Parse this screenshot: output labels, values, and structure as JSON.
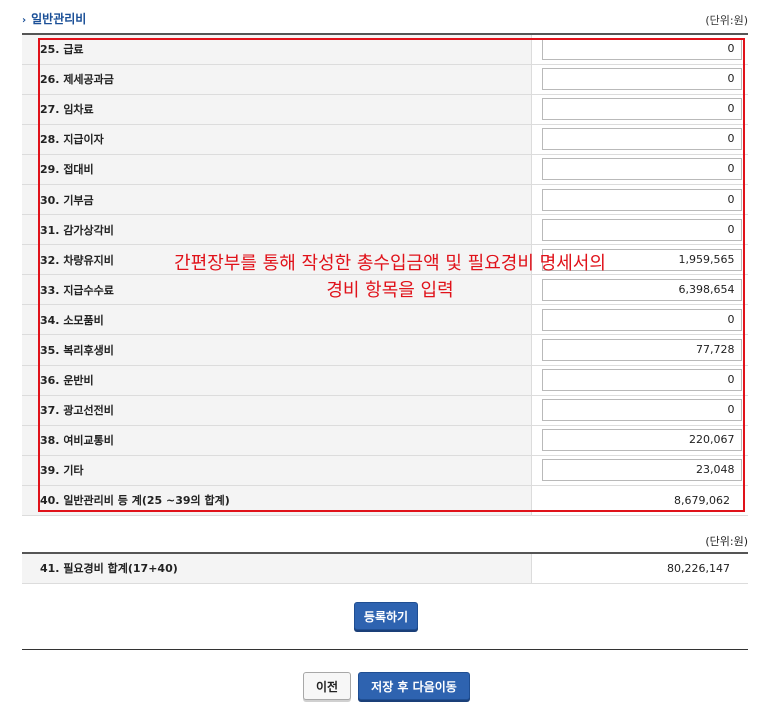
{
  "section": {
    "title": "일반관리비",
    "unit": "(단위:원)"
  },
  "rows": [
    {
      "label": "25. 급료",
      "value": "0"
    },
    {
      "label": "26. 제세공과금",
      "value": "0"
    },
    {
      "label": "27. 임차료",
      "value": "0"
    },
    {
      "label": "28. 지급이자",
      "value": "0"
    },
    {
      "label": "29. 접대비",
      "value": "0"
    },
    {
      "label": "30. 기부금",
      "value": "0"
    },
    {
      "label": "31. 감가상각비",
      "value": "0"
    },
    {
      "label": "32. 차량유지비",
      "value": "1,959,565"
    },
    {
      "label": "33. 지급수수료",
      "value": "6,398,654"
    },
    {
      "label": "34. 소모품비",
      "value": "0"
    },
    {
      "label": "35. 복리후생비",
      "value": "77,728"
    },
    {
      "label": "36. 운반비",
      "value": "0"
    },
    {
      "label": "37. 광고선전비",
      "value": "0"
    },
    {
      "label": "38. 여비교통비",
      "value": "220,067"
    },
    {
      "label": "39. 기타",
      "value": "23,048"
    }
  ],
  "subtotal": {
    "label": "40. 일반관리비 등 계(25 ~39의 합계)",
    "value": "8,679,062"
  },
  "annotation": {
    "line1": "간편장부를 통해 작성한 총수입금액 및 필요경비 명세서의",
    "line2": "경비 항목을 입력"
  },
  "total": {
    "unit": "(단위:원)",
    "label": "41. 필요경비 합계(17+40)",
    "value": "80,226,147"
  },
  "buttons": {
    "register": "등록하기",
    "prev": "이전",
    "save_next": "저장 후 다음이동"
  },
  "colors": {
    "accent": "#2e63b0",
    "annotation_red": "#e0121a"
  }
}
